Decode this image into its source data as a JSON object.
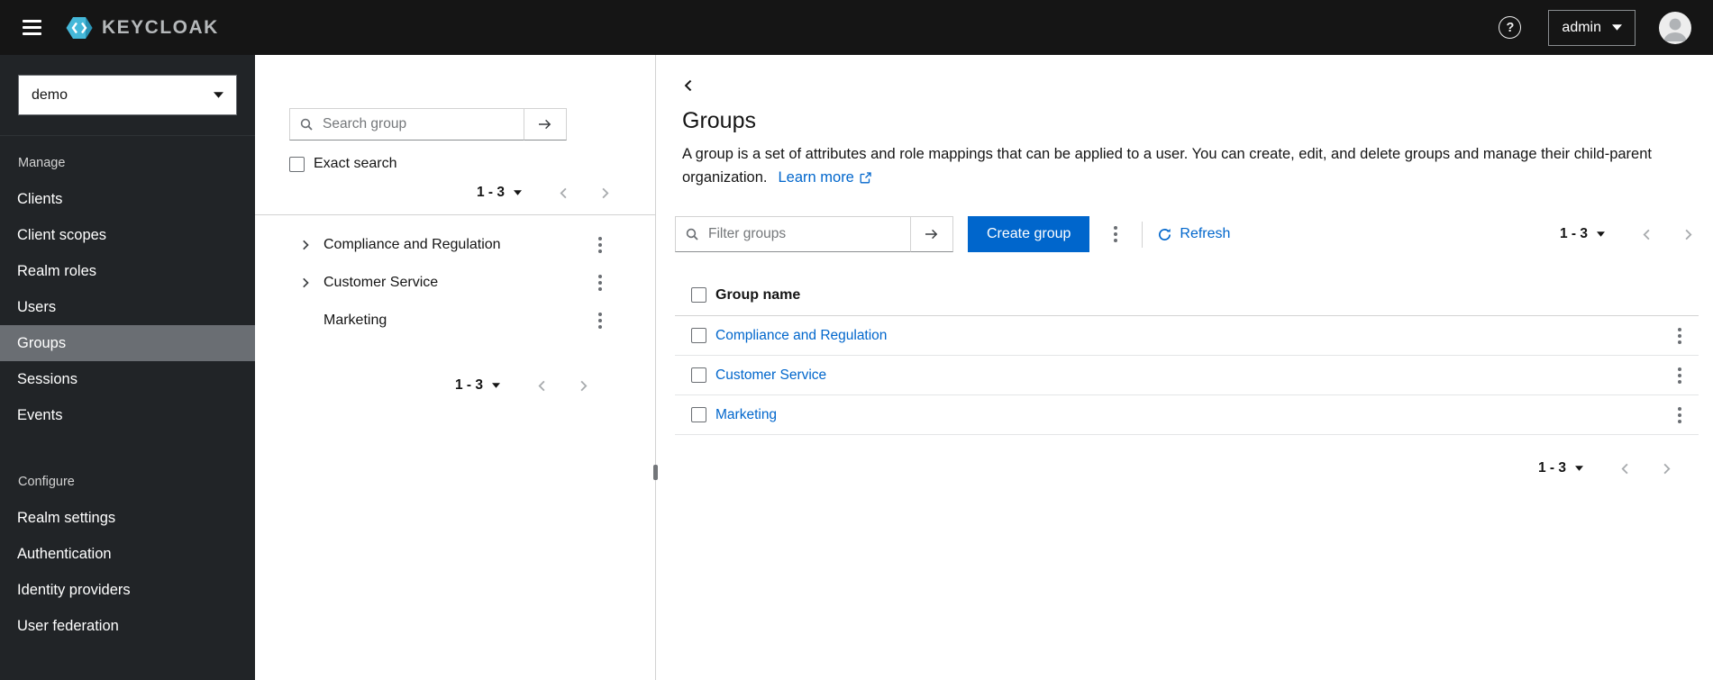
{
  "header": {
    "brand": "KEYCLOAK",
    "username": "admin"
  },
  "sidebar": {
    "realm": "demo",
    "selected_item": "Groups",
    "sections": [
      {
        "label": "Manage",
        "items": [
          "Clients",
          "Client scopes",
          "Realm roles",
          "Users",
          "Groups",
          "Sessions",
          "Events"
        ]
      },
      {
        "label": "Configure",
        "items": [
          "Realm settings",
          "Authentication",
          "Identity providers",
          "User federation"
        ]
      }
    ]
  },
  "tree_panel": {
    "search_placeholder": "Search group",
    "exact_search_label": "Exact search",
    "pagination": "1 - 3",
    "items": [
      {
        "label": "Compliance and Regulation",
        "expandable": true
      },
      {
        "label": "Customer Service",
        "expandable": true
      },
      {
        "label": "Marketing",
        "expandable": false
      }
    ]
  },
  "main": {
    "title": "Groups",
    "description": "A group is a set of attributes and role mappings that can be applied to a user. You can create, edit, and delete groups and manage their child-parent organization.",
    "learn_more_label": "Learn more",
    "filter_placeholder": "Filter groups",
    "create_button_label": "Create group",
    "refresh_label": "Refresh",
    "pagination": "1 - 3",
    "table": {
      "column_header": "Group name",
      "rows": [
        "Compliance and Regulation",
        "Customer Service",
        "Marketing"
      ]
    }
  },
  "colors": {
    "primary": "#0066cc",
    "link": "#0066cc",
    "masthead_bg": "#151515",
    "sidebar_bg": "#212427",
    "sidebar_selected_bg": "#6a6e73",
    "logo_accent": "#45b8d9"
  }
}
